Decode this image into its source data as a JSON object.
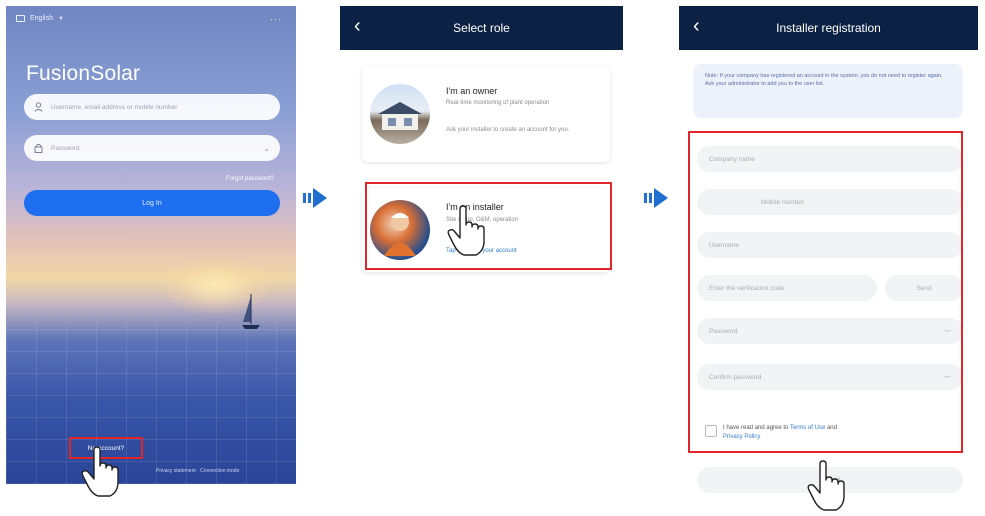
{
  "arrows": {
    "color": "#1f6fd1"
  },
  "login": {
    "language": "English",
    "menu": "···",
    "app_title": "FusionSolar",
    "username_placeholder": "Username, email address or mobile number",
    "password_placeholder": "Password",
    "forgot_password": "Forgot password?",
    "login_button": "Log In",
    "no_account": "No account?",
    "bottom_link": "Privacy statement · Connection mode"
  },
  "select_role": {
    "title": "Select role",
    "owner": {
      "title": "I'm an owner",
      "desc": "Real-time monitoring of plant operation",
      "desc2": "Ask your installer to create an account for you."
    },
    "installer": {
      "title": "I'm an installer",
      "desc": "Site setup, O&M, operation",
      "link": "Tap to create your account"
    }
  },
  "registration": {
    "title": "Installer registration",
    "note": "Note: If your company has registered an account in the system, you do not need to register again. Ask your administrator to add you to the user list.",
    "company_name": "Company name",
    "mobile_number": "Mobile number",
    "username": "Username",
    "verification_code": "Enter the verification code",
    "send": "Send",
    "password": "Password",
    "confirm_password": "Confirm password",
    "agree_prefix": "I have read and agree to",
    "terms": "Terms of Use",
    "and": "and",
    "privacy": "Privacy Policy",
    "submit": "Submit"
  },
  "highlight_color": "#e1262b"
}
